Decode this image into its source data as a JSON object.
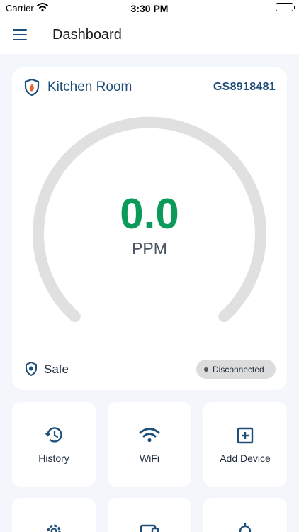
{
  "status_bar": {
    "carrier": "Carrier",
    "time": "3:30 PM"
  },
  "app_bar": {
    "title": "Dashboard"
  },
  "device": {
    "room": "Kitchen Room",
    "serial": "GS8918481",
    "reading": "0.0",
    "unit": "PPM",
    "level_fraction": 0,
    "status": "Safe",
    "connection": "Disconnected"
  },
  "colors": {
    "primary": "#1f4e79",
    "reading": "#0b9a5a",
    "gauge_track": "#e0e0e0",
    "background": "#f3f6fa"
  },
  "tiles": [
    {
      "label": "History",
      "icon": "history-icon"
    },
    {
      "label": "WiFi",
      "icon": "wifi-icon"
    },
    {
      "label": "Add Device",
      "icon": "add-box-icon"
    },
    {
      "label": "",
      "icon": "settings-icon"
    },
    {
      "label": "",
      "icon": "devices-icon"
    },
    {
      "label": "",
      "icon": "bulb-icon"
    }
  ]
}
